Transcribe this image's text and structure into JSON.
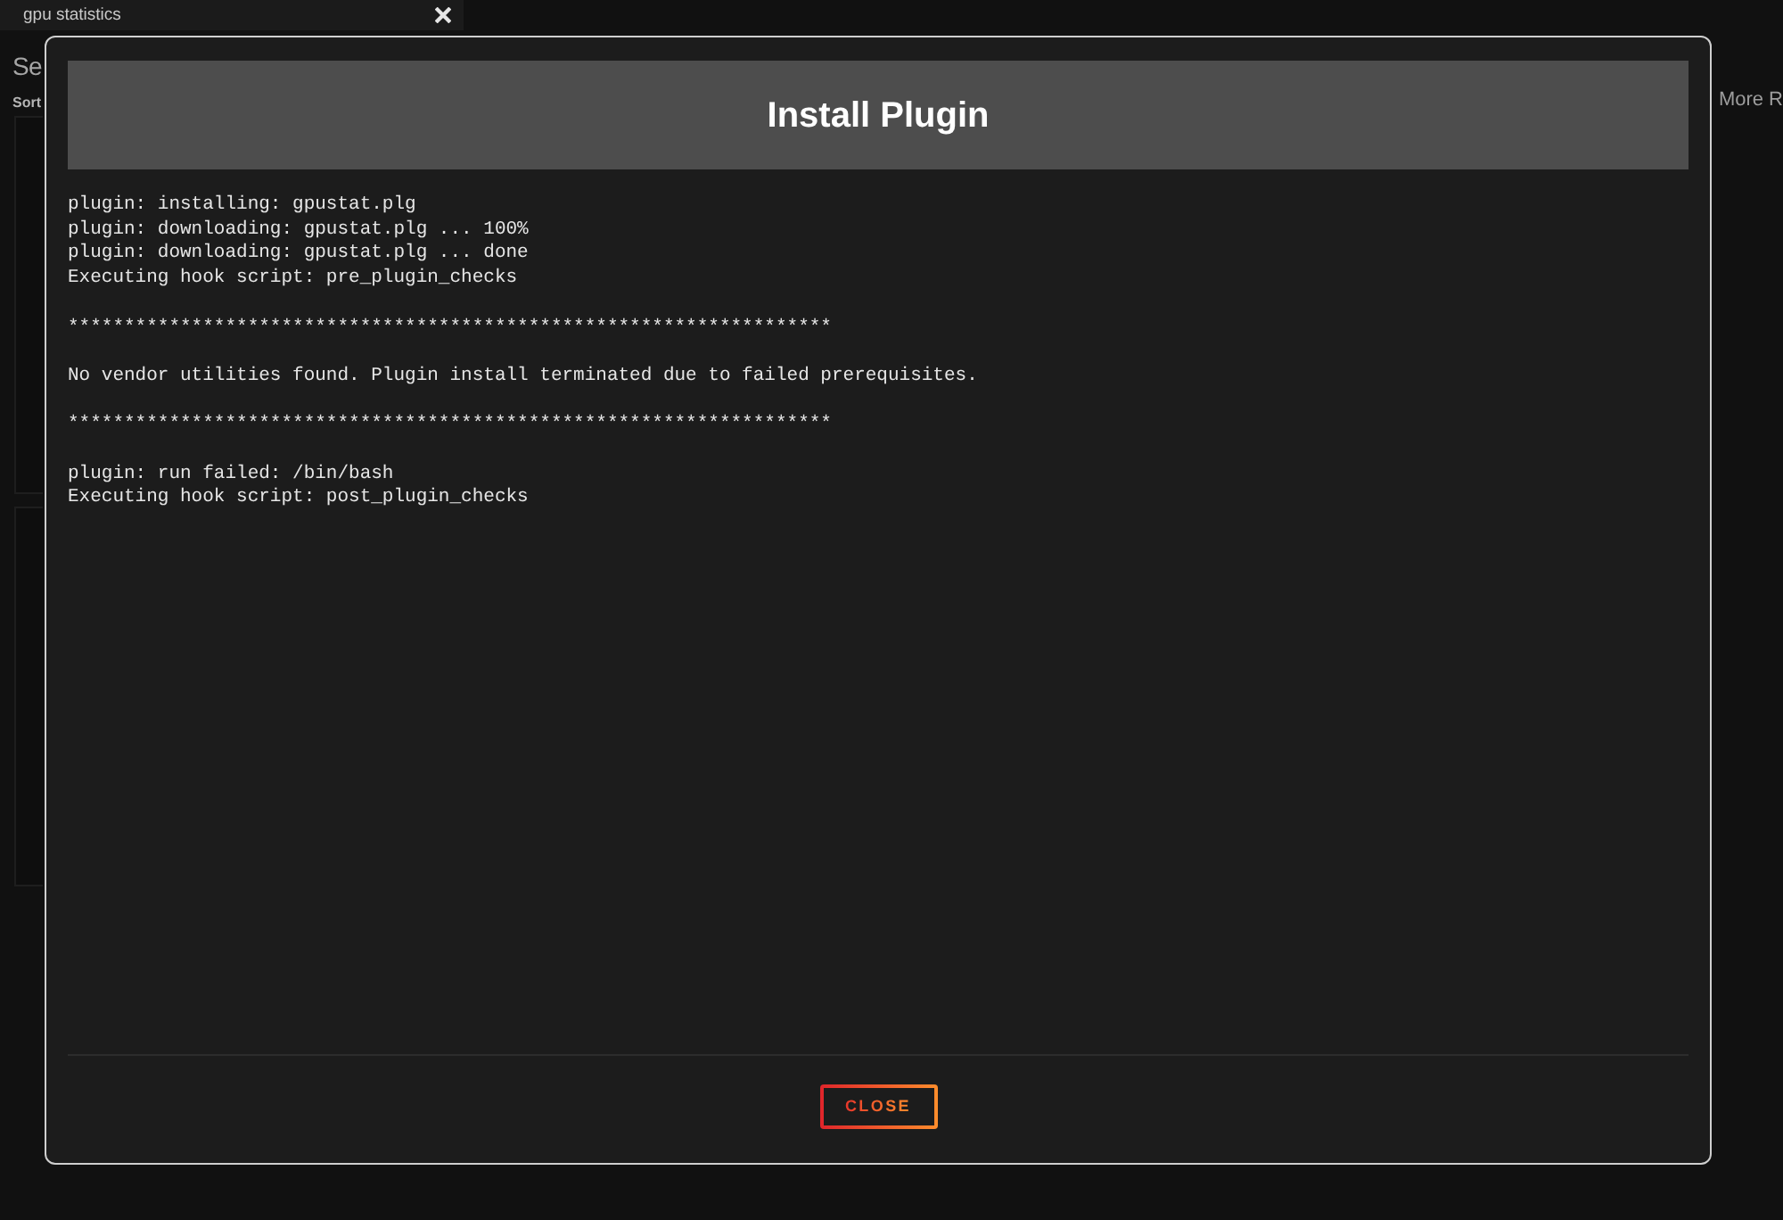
{
  "background": {
    "tab": {
      "label": "gpu statistics"
    },
    "heading": "Se",
    "sort_label": "Sort",
    "right_link": "More R"
  },
  "dialog": {
    "title": "Install Plugin",
    "log": [
      [
        "plugin: installing: gpustat.plg",
        "plugin: downloading: gpustat.plg ... 100%",
        "plugin: downloading: gpustat.plg ... done",
        "Executing hook script: pre_plugin_checks"
      ],
      [
        "********************************************************************"
      ],
      [
        "No vendor utilities found. Plugin install terminated due to failed prerequisites."
      ],
      [
        "********************************************************************"
      ],
      [
        "plugin: run failed: /bin/bash",
        "Executing hook script: post_plugin_checks"
      ]
    ],
    "buttons": [
      "CLOSE"
    ]
  }
}
